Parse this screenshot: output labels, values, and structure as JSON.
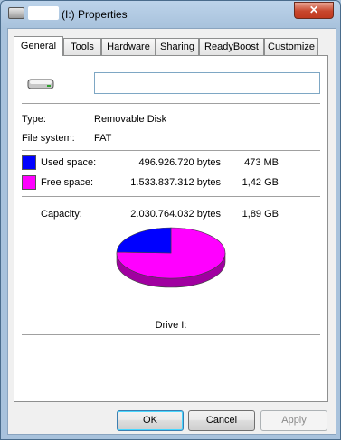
{
  "window": {
    "title": "(I:) Properties",
    "close_label": "✕"
  },
  "tabs": [
    {
      "label": "General",
      "active": true
    },
    {
      "label": "Tools"
    },
    {
      "label": "Hardware"
    },
    {
      "label": "Sharing"
    },
    {
      "label": "ReadyBoost"
    },
    {
      "label": "Customize"
    }
  ],
  "general": {
    "drive_icon": "removable-drive-icon",
    "name_value": "",
    "type_label": "Type:",
    "type_value": "Removable Disk",
    "fs_label": "File system:",
    "fs_value": "FAT",
    "used": {
      "label": "Used space:",
      "bytes": "496.926.720 bytes",
      "size": "473 MB",
      "color": "#0000ff"
    },
    "free": {
      "label": "Free space:",
      "bytes": "1.533.837.312 bytes",
      "size": "1,42 GB",
      "color": "#ff00ff"
    },
    "capacity": {
      "label": "Capacity:",
      "bytes": "2.030.764.032 bytes",
      "size": "1,89 GB"
    },
    "used_fraction": 0.2447,
    "drive_label": "Drive I:"
  },
  "buttons": {
    "ok": "OK",
    "cancel": "Cancel",
    "apply": "Apply"
  }
}
